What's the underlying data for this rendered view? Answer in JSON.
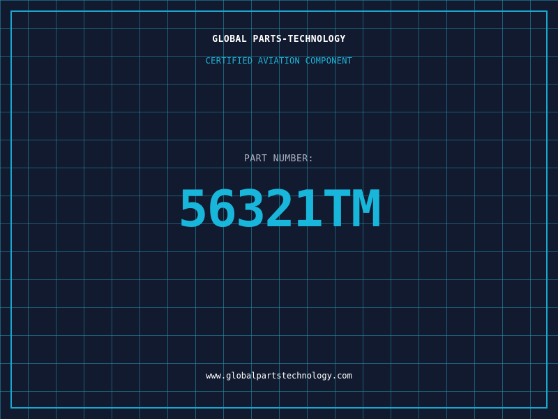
{
  "header": {
    "company": "GLOBAL PARTS-TECHNOLOGY",
    "subtitle": "CERTIFIED AVIATION COMPONENT"
  },
  "part": {
    "label": "PART NUMBER:",
    "number": "56321TM"
  },
  "footer": {
    "website": "www.globalpartstechnology.com"
  },
  "colors": {
    "background": "#111a2e",
    "grid": "#2896af",
    "accent": "#19b6dc",
    "label": "#a9b3c2",
    "text": "#ffffff"
  }
}
